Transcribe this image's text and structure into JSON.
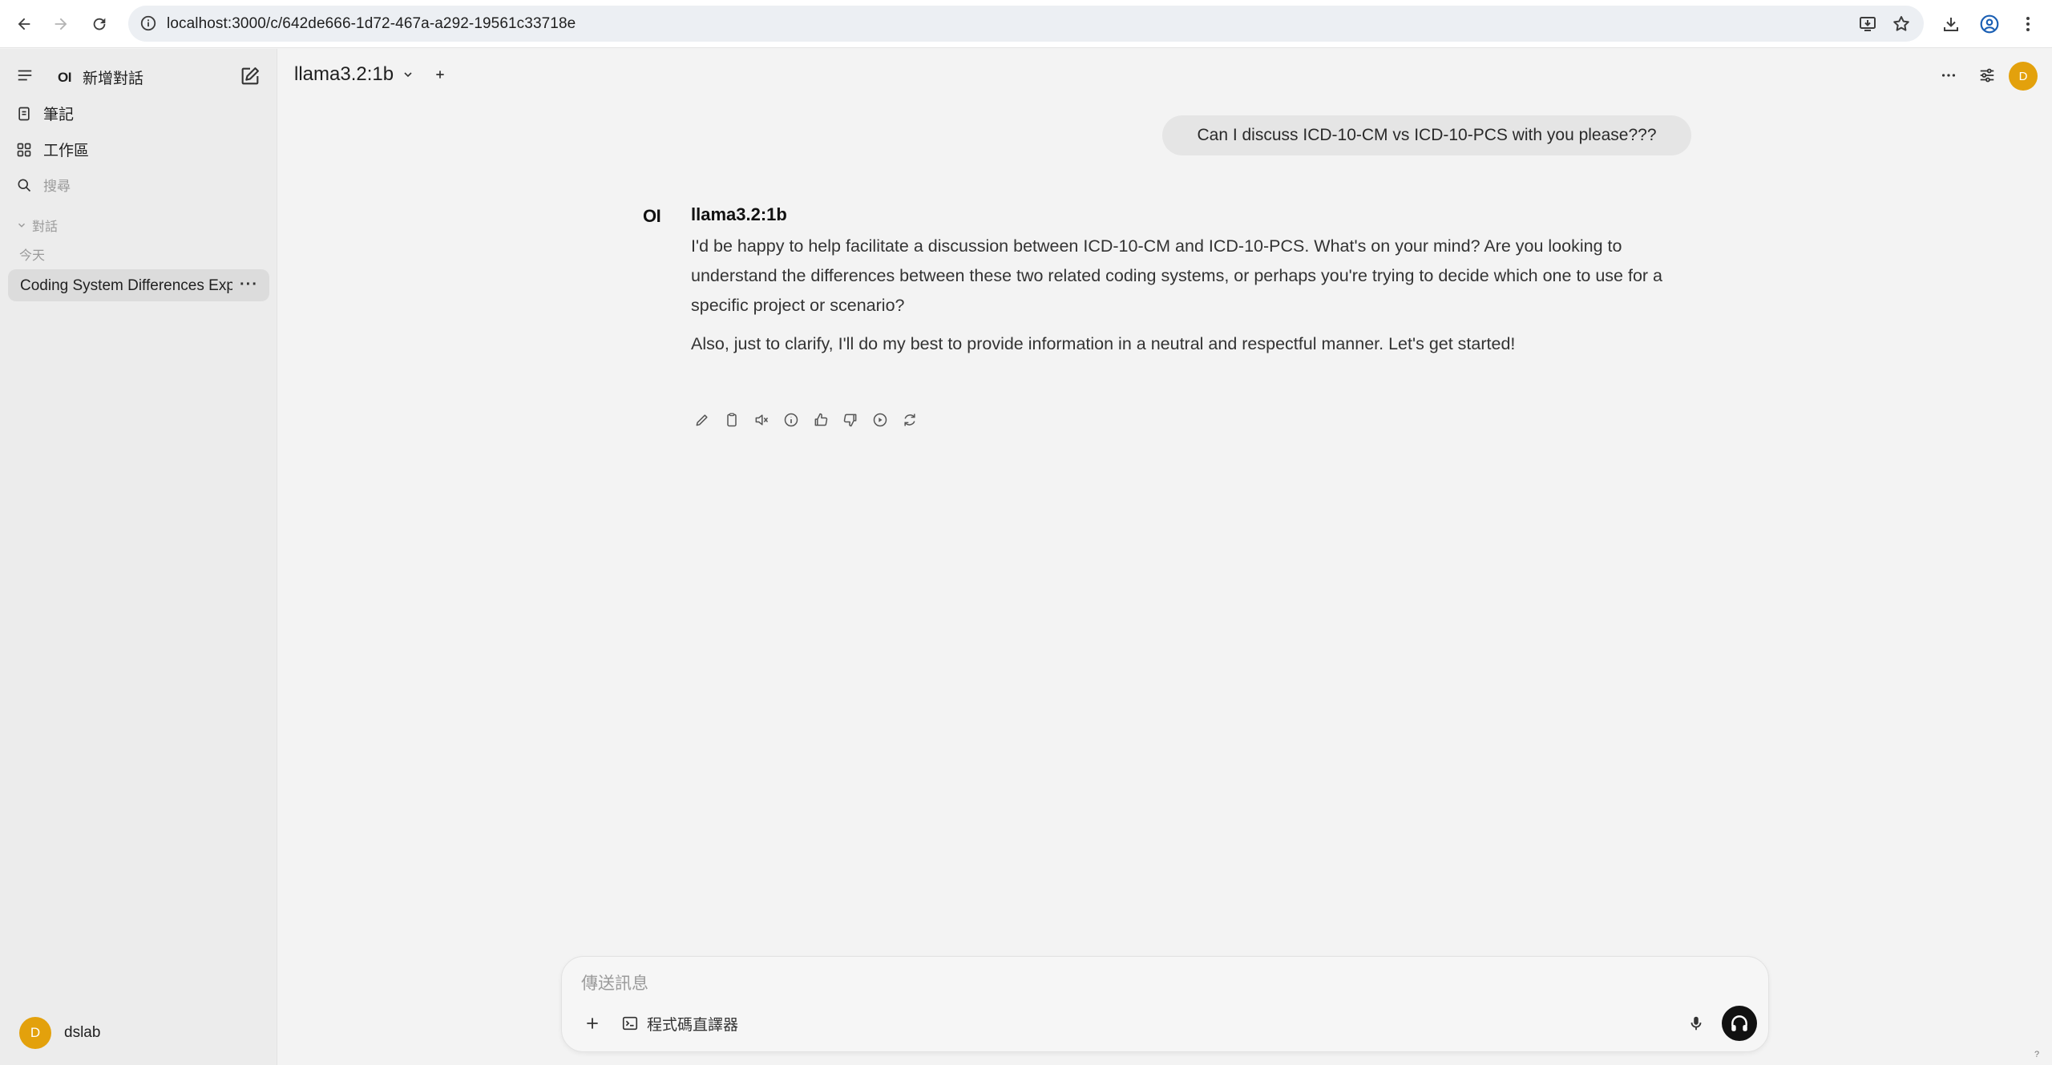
{
  "browser": {
    "url": "localhost:3000/c/642de666-1d72-467a-a292-19561c33718e"
  },
  "sidebar": {
    "logo": "OI",
    "new_chat_label": "新增對話",
    "notes_label": "筆記",
    "workspace_label": "工作區",
    "search_placeholder": "搜尋",
    "chats_section_label": "對話",
    "today_label": "今天",
    "chats": [
      {
        "title": "Coding System Differences Explained"
      }
    ],
    "user": {
      "avatar_initial": "D",
      "name": "dslab"
    }
  },
  "header": {
    "model_name": "llama3.2:1b",
    "user_avatar_initial": "D"
  },
  "conversation": {
    "user_message": "Can I discuss ICD-10-CM vs ICD-10-PCS with you please???",
    "assistant": {
      "logo": "OI",
      "model_name": "llama3.2:1b",
      "paragraphs": [
        "I'd be happy to help facilitate a discussion between ICD-10-CM and ICD-10-PCS. What's on your mind? Are you looking to understand the differences between these two related coding systems, or perhaps you're trying to decide which one to use for a specific project or scenario?",
        "Also, just to clarify, I'll do my best to provide information in a neutral and respectful manner. Let's get started!"
      ],
      "actions": [
        "edit-icon",
        "copy-icon",
        "speaker-mute-icon",
        "info-icon",
        "thumbs-up-icon",
        "thumbs-down-icon",
        "play-icon",
        "regenerate-icon"
      ]
    }
  },
  "composer": {
    "placeholder": "傳送訊息",
    "code_interpreter_label": "程式碼直譯器"
  },
  "help_label": "?"
}
